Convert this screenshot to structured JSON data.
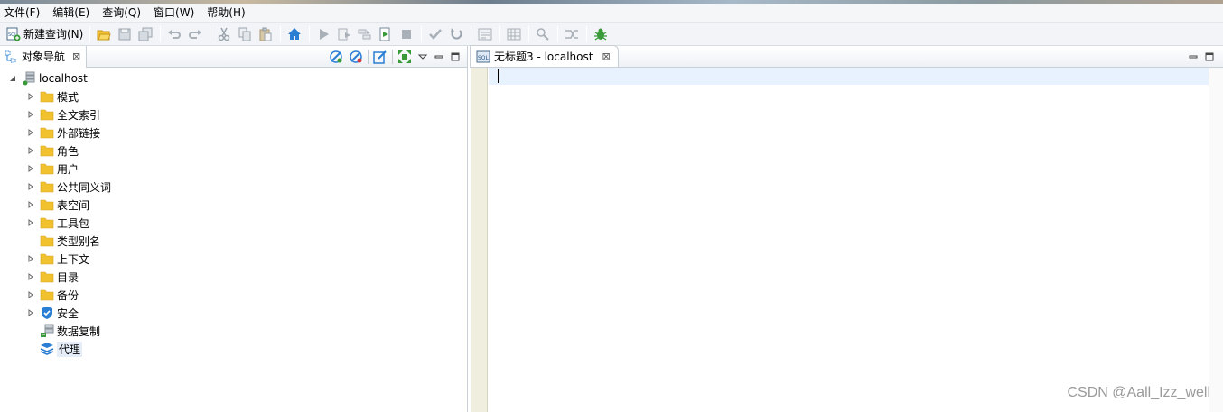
{
  "menu": {
    "items": [
      {
        "label": "文件(F)",
        "name": "menu-file"
      },
      {
        "label": "编辑(E)",
        "name": "menu-edit"
      },
      {
        "label": "查询(Q)",
        "name": "menu-query"
      },
      {
        "label": "窗口(W)",
        "name": "menu-window"
      },
      {
        "label": "帮助(H)",
        "name": "menu-help"
      }
    ]
  },
  "toolbar": {
    "new_query_label": "新建查询(N)"
  },
  "navigator": {
    "tab_title": "对象导航",
    "close_glyph": "⊠",
    "root": {
      "label": "localhost"
    },
    "items": [
      {
        "label": "模式",
        "icon": "folder-icon",
        "has_arrow": true
      },
      {
        "label": "全文索引",
        "icon": "folder-icon",
        "has_arrow": true
      },
      {
        "label": "外部链接",
        "icon": "folder-icon",
        "has_arrow": true
      },
      {
        "label": "角色",
        "icon": "folder-icon",
        "has_arrow": true
      },
      {
        "label": "用户",
        "icon": "folder-icon",
        "has_arrow": true
      },
      {
        "label": "公共同义词",
        "icon": "folder-icon",
        "has_arrow": true
      },
      {
        "label": "表空间",
        "icon": "folder-icon",
        "has_arrow": true
      },
      {
        "label": "工具包",
        "icon": "folder-icon",
        "has_arrow": true
      },
      {
        "label": "类型别名",
        "icon": "folder-icon",
        "has_arrow": false
      },
      {
        "label": "上下文",
        "icon": "folder-icon",
        "has_arrow": true
      },
      {
        "label": "目录",
        "icon": "folder-icon",
        "has_arrow": true
      },
      {
        "label": "备份",
        "icon": "folder-icon",
        "has_arrow": true
      },
      {
        "label": "安全",
        "icon": "shield-icon",
        "has_arrow": true
      },
      {
        "label": "数据复制",
        "icon": "replication-icon",
        "has_arrow": false
      },
      {
        "label": "代理",
        "icon": "layers-icon",
        "has_arrow": false
      }
    ]
  },
  "editor": {
    "tab_title": "无标题3 - localhost",
    "close_glyph": "⊠",
    "content": ""
  },
  "watermark": "CSDN @Aall_Izz_well",
  "colors": {
    "folder": "#f2c12e",
    "accent_blue": "#2a7fd4",
    "green": "#3a9a3a",
    "current_line": "#e8f2fe",
    "gutter": "#efeedf"
  }
}
